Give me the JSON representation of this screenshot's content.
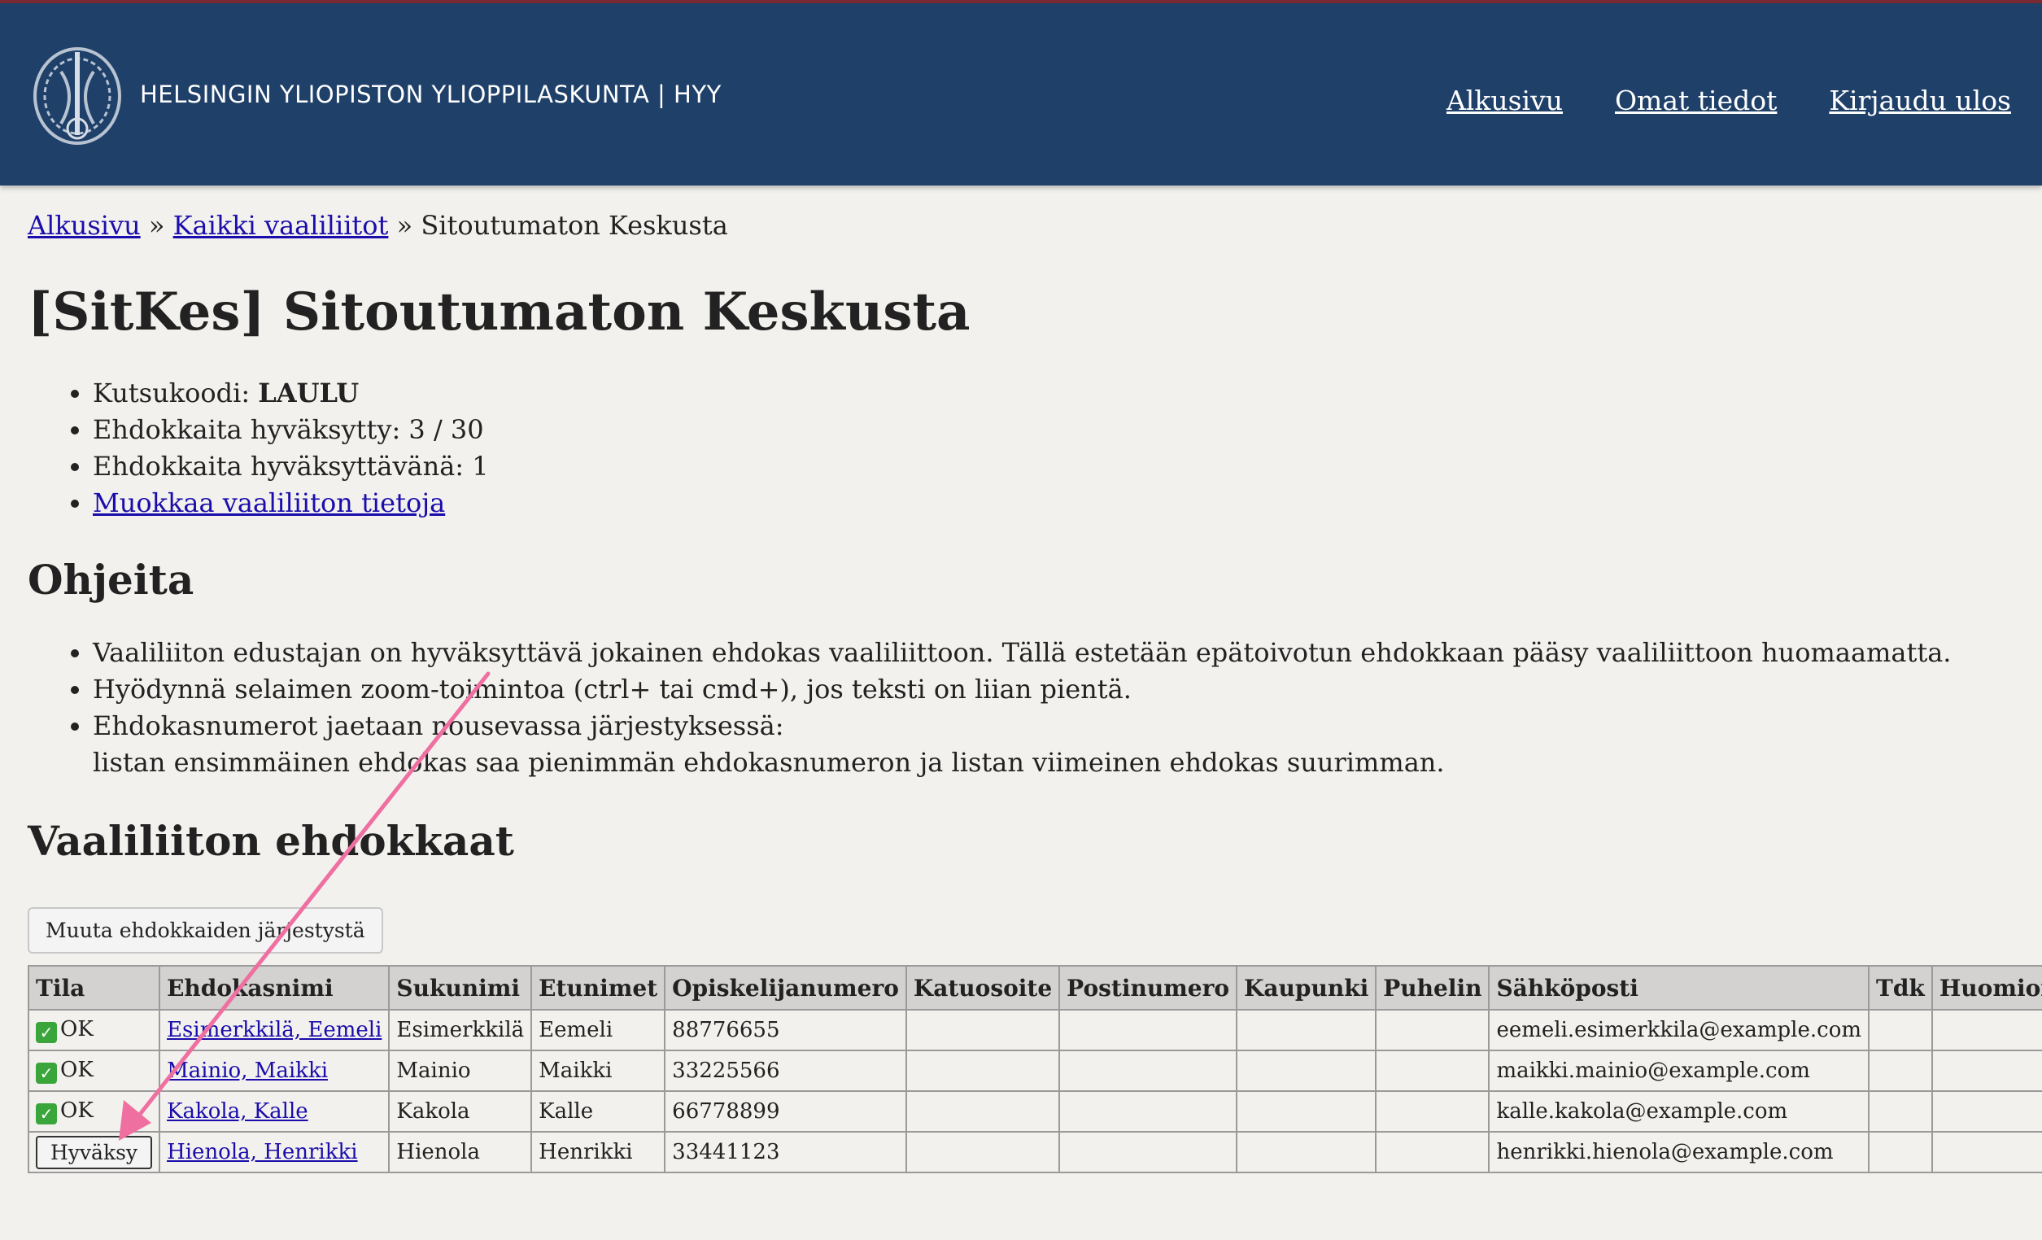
{
  "header": {
    "logo_text": "HELSINGIN YLIOPISTON YLIOPPILASKUNTA | HYY",
    "nav": [
      "Alkusivu",
      "Omat tiedot",
      "Kirjaudu ulos"
    ]
  },
  "breadcrumb": {
    "home": "Alkusivu",
    "sep1": "»",
    "all": "Kaikki vaaliliitot",
    "sep2": "»",
    "current": "Sitoutumaton Keskusta"
  },
  "page_title": "[SitKes] Sitoutumaton Keskusta",
  "info": {
    "code_label": "Kutsukoodi: ",
    "code_value": "LAULU",
    "approved": "Ehdokkaita hyväksytty: 3 / 30",
    "pending": "Ehdokkaita hyväksyttävänä: 1",
    "edit_link": "Muokkaa vaaliliiton tietoja"
  },
  "help": {
    "title": "Ohjeita",
    "items": [
      "Vaaliliiton edustajan on hyväksyttävä jokainen ehdokas vaaliliittoon. Tällä estetään epätoivotun ehdokkaan pääsy vaaliliittoon huomaamatta.",
      "Hyödynnä selaimen zoom-toimintoa (ctrl+ tai cmd+), jos teksti on liian pientä.",
      "Ehdokasnumerot jaetaan nousevassa järjestyksessä:",
      "listan ensimmäinen ehdokas saa pienimmän ehdokasnumeron ja listan viimeinen ehdokas suurimman."
    ]
  },
  "candidates": {
    "title": "Vaaliliiton ehdokkaat",
    "reorder_button": "Muuta ehdokkaiden järjestystä",
    "columns": [
      "Tila",
      "Ehdokasnimi",
      "Sukunimi",
      "Etunimet",
      "Opiskelijanumero",
      "Katuosoite",
      "Postinumero",
      "Kaupunki",
      "Puhelin",
      "Sähköposti",
      "Tdk",
      "Huomioita"
    ],
    "rows": [
      {
        "status": "OK",
        "name": "Esimerkkilä, Eemeli",
        "last": "Esimerkkilä",
        "first": "Eemeli",
        "student_no": "88776655",
        "street": "",
        "postal": "",
        "city": "",
        "phone": "",
        "email": "eemeli.esimerkkila@example.com",
        "faculty": "",
        "notes": ""
      },
      {
        "status": "OK",
        "name": "Mainio, Maikki",
        "last": "Mainio",
        "first": "Maikki",
        "student_no": "33225566",
        "street": "",
        "postal": "",
        "city": "",
        "phone": "",
        "email": "maikki.mainio@example.com",
        "faculty": "",
        "notes": ""
      },
      {
        "status": "OK",
        "name": "Kakola, Kalle",
        "last": "Kakola",
        "first": "Kalle",
        "student_no": "66778899",
        "street": "",
        "postal": "",
        "city": "",
        "phone": "",
        "email": "kalle.kakola@example.com",
        "faculty": "",
        "notes": ""
      },
      {
        "status": "",
        "approve_button": "Hyväksy",
        "name": "Hienola, Henrikki",
        "last": "Hienola",
        "first": "Henrikki",
        "student_no": "33441123",
        "street": "",
        "postal": "",
        "city": "",
        "phone": "",
        "email": "henrikki.hienola@example.com",
        "faculty": "",
        "notes": ""
      }
    ]
  },
  "colors": {
    "header_bg": "#1f4069",
    "page_bg": "#f2f1ee",
    "link": "#1a0dab",
    "arrow": "#ef6fa1",
    "ok_check": "#3aa53a"
  },
  "icons": {
    "ok": "check-box-icon",
    "logo": "hyy-seal-icon",
    "annotation": "pointer-arrow-icon"
  }
}
